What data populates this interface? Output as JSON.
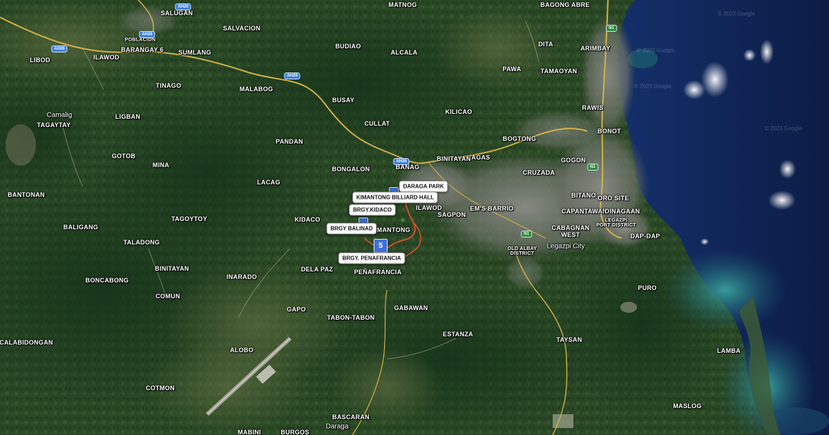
{
  "map": {
    "style": "satellite",
    "colors": {
      "land": "#2c4a26",
      "forest": "#1f3d1c",
      "urban": "#7d7f79",
      "sea": "#0e2250",
      "shallow": "#1f6f7a",
      "route": "#d9502a",
      "road": "#d4b24a"
    }
  },
  "places": [
    {
      "id": "salugan",
      "text": "SALUGAN"
    },
    {
      "id": "poblacion",
      "text": "POBLACION"
    },
    {
      "id": "salvacion",
      "text": "SALVACION"
    },
    {
      "id": "matnog",
      "text": "MATNOG"
    },
    {
      "id": "bagong-abre",
      "text": "BAGONG ABRE"
    },
    {
      "id": "libod",
      "text": "LIBOD"
    },
    {
      "id": "ilawod-west",
      "text": "ILAWOD"
    },
    {
      "id": "barangay-6",
      "text": "BARANGAY 6"
    },
    {
      "id": "sumlang",
      "text": "SUMLANG"
    },
    {
      "id": "budiao",
      "text": "BUDIAO"
    },
    {
      "id": "alcala",
      "text": "ALCALA"
    },
    {
      "id": "dita",
      "text": "DITA"
    },
    {
      "id": "arimbay",
      "text": "ARIMBAY"
    },
    {
      "id": "pawa",
      "text": "PAWA"
    },
    {
      "id": "tamaoyan",
      "text": "TAMAOYAN"
    },
    {
      "id": "tinago",
      "text": "TINAGO"
    },
    {
      "id": "malabog",
      "text": "MALABOG"
    },
    {
      "id": "camalig",
      "text": "Camalig"
    },
    {
      "id": "tagaytay",
      "text": "TAGAYTAY"
    },
    {
      "id": "busay",
      "text": "BUSAY"
    },
    {
      "id": "kilicao",
      "text": "KILICAO"
    },
    {
      "id": "rawis",
      "text": "RAWIS"
    },
    {
      "id": "ligban",
      "text": "LIGBAN"
    },
    {
      "id": "cullat",
      "text": "CULLAT"
    },
    {
      "id": "pandan",
      "text": "PANDAN"
    },
    {
      "id": "bogtong",
      "text": "BOGTONG"
    },
    {
      "id": "bonot",
      "text": "BONOT"
    },
    {
      "id": "gotob",
      "text": "GOTOB"
    },
    {
      "id": "mina",
      "text": "MINA"
    },
    {
      "id": "bongalon",
      "text": "BONGALON"
    },
    {
      "id": "binitayan-east",
      "text": "BINITAYAN"
    },
    {
      "id": "banag",
      "text": "BANAG"
    },
    {
      "id": "agas",
      "text": "AGAS"
    },
    {
      "id": "gogon",
      "text": "GOGON"
    },
    {
      "id": "cruzada",
      "text": "CRUZADA"
    },
    {
      "id": "bantonan",
      "text": "BANTONAN"
    },
    {
      "id": "lacag",
      "text": "LACAG"
    },
    {
      "id": "bitano",
      "text": "BITANO"
    },
    {
      "id": "oro-site",
      "text": "ORO SITE"
    },
    {
      "id": "ilawod-east",
      "text": "ILAWOD"
    },
    {
      "id": "ems-barrio",
      "text": "EM'S BARRIO"
    },
    {
      "id": "capantawan",
      "text": "CAPANTAWAN"
    },
    {
      "id": "dinagaan",
      "text": "DINAGAAN"
    },
    {
      "id": "tagoytoy",
      "text": "TAGOYTOY"
    },
    {
      "id": "baligang",
      "text": "BALIGANG"
    },
    {
      "id": "kidaco",
      "text": "KIDACO"
    },
    {
      "id": "sagpon",
      "text": "SAGPON"
    },
    {
      "id": "cabagnan-west",
      "text": "CABAGNAN\nWEST"
    },
    {
      "id": "legazpi-port",
      "text": "LEGAZPI\nPORT DISTRICT"
    },
    {
      "id": "dap-dap",
      "text": "DAP-DAP"
    },
    {
      "id": "kimantong",
      "text": "KIMANTONG"
    },
    {
      "id": "taladong",
      "text": "TALADONG"
    },
    {
      "id": "legazpi-city",
      "text": "Legazpi City"
    },
    {
      "id": "old-albay",
      "text": "OLD ALBAY\nDISTRICT"
    },
    {
      "id": "binitayan-west",
      "text": "BINITAYAN"
    },
    {
      "id": "dela-paz",
      "text": "DELA PAZ"
    },
    {
      "id": "inarado",
      "text": "INARADO"
    },
    {
      "id": "penafrancia",
      "text": "PEÑAFRANCIA"
    },
    {
      "id": "bongabong",
      "text": "BONCABONG"
    },
    {
      "id": "puro",
      "text": "PURO"
    },
    {
      "id": "comun",
      "text": "COMUN"
    },
    {
      "id": "gapo",
      "text": "GAPO"
    },
    {
      "id": "gabawan",
      "text": "GABAWAN"
    },
    {
      "id": "tabon-tabon",
      "text": "TABON-TABON"
    },
    {
      "id": "calabidongan",
      "text": "CALABIDONGAN"
    },
    {
      "id": "estanza",
      "text": "ESTANZA"
    },
    {
      "id": "taysan",
      "text": "TAYSAN"
    },
    {
      "id": "alobo",
      "text": "ALOBO"
    },
    {
      "id": "lamba",
      "text": "LAMBA"
    },
    {
      "id": "cotmon",
      "text": "COTMON"
    },
    {
      "id": "maslog",
      "text": "MASLOG"
    },
    {
      "id": "bascaran",
      "text": "BASCARAN"
    },
    {
      "id": "daraga",
      "text": "Daraga"
    },
    {
      "id": "mabini",
      "text": "MABINI"
    },
    {
      "id": "burgos",
      "text": "BURGOS"
    }
  ],
  "road_shields": [
    {
      "id": "ah26-1",
      "text": "AH26"
    },
    {
      "id": "ah26-2",
      "text": "AH26"
    },
    {
      "id": "ah26-3",
      "text": "AH26"
    },
    {
      "id": "ah26-4",
      "text": "AH26"
    },
    {
      "id": "ah26-5",
      "text": "AH26"
    },
    {
      "id": "n1",
      "text": "N1"
    },
    {
      "id": "n2",
      "text": "N1"
    },
    {
      "id": "n3",
      "text": "N1"
    }
  ],
  "markers": [
    {
      "id": "daraga-park",
      "text": "DARAGA PARK"
    },
    {
      "id": "kimantong-billiard-hall",
      "text": "KIMANTONG BILLIARD HALL"
    },
    {
      "id": "brgy-kidaco",
      "text": "BRGY.KIDACO"
    },
    {
      "id": "brgy-balinad",
      "text": "BRGY BALINAD"
    },
    {
      "id": "brgy-penafrancia",
      "text": "BRGY. PENAFRANCIA"
    }
  ],
  "pin": {
    "label": "5"
  },
  "watermarks": [
    "© 2023 Google",
    "© 2023 Google",
    "© 2023 Google",
    "© 2023 Google"
  ]
}
